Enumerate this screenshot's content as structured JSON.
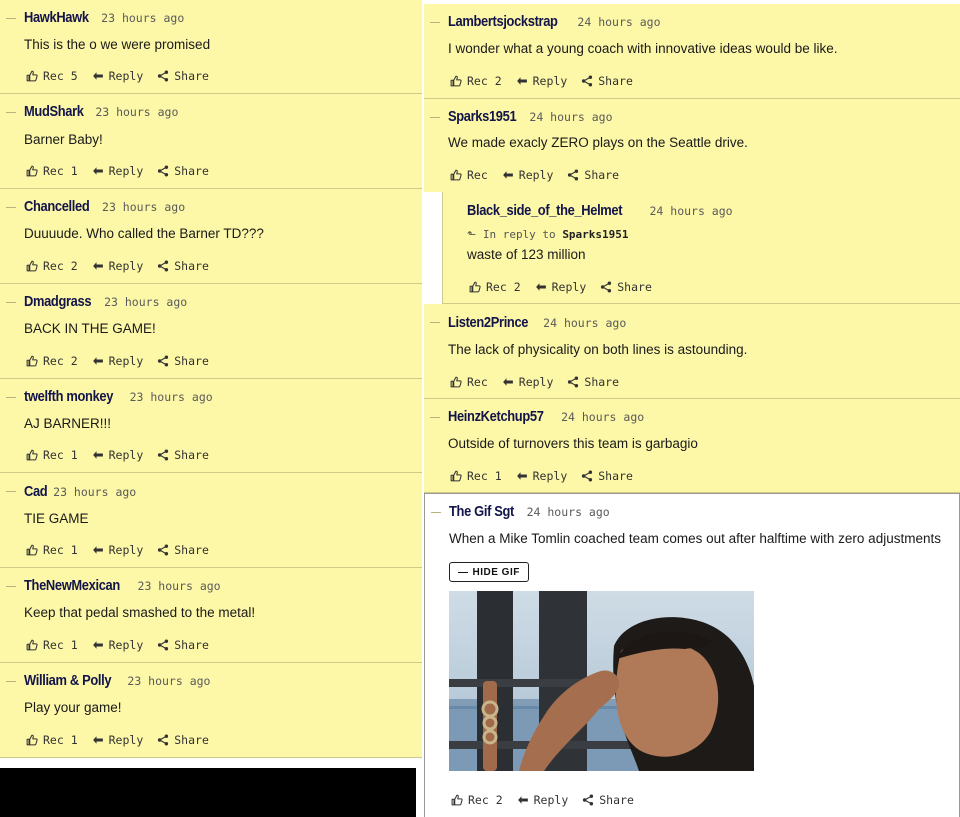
{
  "left_comments": [
    {
      "username": "HawkHawk",
      "time": "23 hours ago",
      "text": "This is the o we were promised",
      "rec": "Rec 5",
      "reply": "Reply",
      "share": "Share"
    },
    {
      "username": "MudShark",
      "time": "23 hours ago",
      "text": "Barner Baby!",
      "rec": "Rec 1",
      "reply": "Reply",
      "share": "Share"
    },
    {
      "username": "Chancelled",
      "time": "23 hours ago",
      "text": "Duuuude. Who called the Barner TD???",
      "rec": "Rec 2",
      "reply": "Reply",
      "share": "Share"
    },
    {
      "username": "Dmadgrass",
      "time": "23 hours ago",
      "text": "BACK IN THE GAME!",
      "rec": "Rec 2",
      "reply": "Reply",
      "share": "Share"
    },
    {
      "username": "twelfth monkey",
      "time": "23 hours ago",
      "text": "AJ BARNER!!!",
      "rec": "Rec 1",
      "reply": "Reply",
      "share": "Share"
    },
    {
      "username": "Cad",
      "time": "23 hours ago",
      "text": "TIE GAME",
      "rec": "Rec 1",
      "reply": "Reply",
      "share": "Share"
    },
    {
      "username": "TheNewMexican",
      "time": "23 hours ago",
      "text": "Keep that pedal smashed to the metal!",
      "rec": "Rec 1",
      "reply": "Reply",
      "share": "Share"
    },
    {
      "username": "William & Polly",
      "time": "23 hours ago",
      "text": "Play your game!",
      "rec": "Rec 1",
      "reply": "Reply",
      "share": "Share"
    }
  ],
  "right_comments": [
    {
      "username": "Lambertsjockstrap",
      "time": "24 hours ago",
      "text": "I wonder what a young coach with innovative ideas would be like.",
      "rec": "Rec 2",
      "reply": "Reply",
      "share": "Share"
    },
    {
      "username": "Sparks1951",
      "time": "24 hours ago",
      "text": "We made exacly ZERO plays on the Seattle drive.",
      "rec": "Rec",
      "reply": "Reply",
      "share": "Share"
    },
    {
      "username": "Black_side_of_the_Helmet",
      "time": "24 hours ago",
      "in_reply_prefix": "In reply to",
      "in_reply_to": "Sparks1951",
      "text": "waste of 123 million",
      "rec": "Rec 2",
      "reply": "Reply",
      "share": "Share"
    },
    {
      "username": "Listen2Prince",
      "time": "24 hours ago",
      "text": "The lack of physicality on both lines is astounding.",
      "rec": "Rec",
      "reply": "Reply",
      "share": "Share"
    },
    {
      "username": "HeinzKetchup57",
      "time": "24 hours ago",
      "text": "Outside of turnovers this team is garbagio",
      "rec": "Rec 1",
      "reply": "Reply",
      "share": "Share"
    },
    {
      "username": "The Gif Sgt",
      "time": "24 hours ago",
      "text": "When a Mike Tomlin coached team comes out after halftime with zero adjustments",
      "gif_button": "HIDE GIF",
      "rec": "Rec 2",
      "reply": "Reply",
      "share": "Share"
    }
  ],
  "icons": {
    "rec": "thumbs-up-icon",
    "reply": "reply-arrow-icon",
    "share": "share-icon"
  },
  "colors": {
    "comment_bg": "#fdf7a8",
    "username": "#12144a",
    "divider": "#cfc98a"
  }
}
